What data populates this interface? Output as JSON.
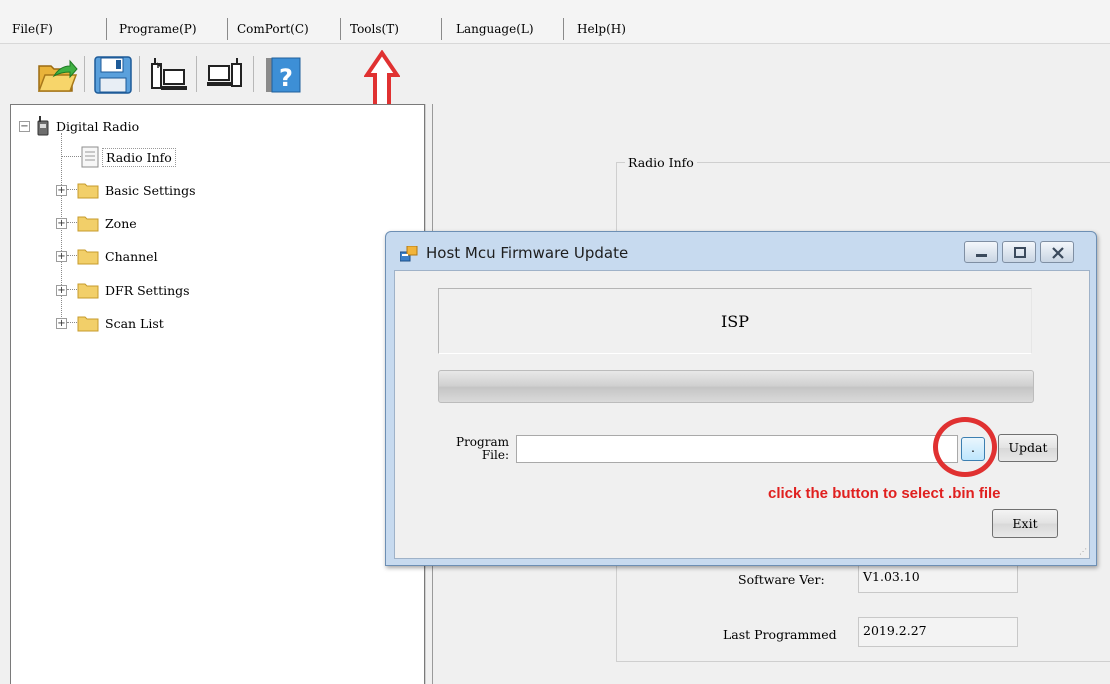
{
  "menu": {
    "items": [
      "File(F)",
      "Programe(P)",
      "ComPort(C)",
      "Tools(T)",
      "Language(L)",
      "Help(H)"
    ]
  },
  "toolbar": {
    "buttons": [
      "open-folder-icon",
      "save-disk-icon",
      "read-from-radio-icon",
      "write-to-radio-icon",
      "help-icon"
    ]
  },
  "tree": {
    "root": "Digital Radio",
    "items": [
      "Radio Info",
      "Basic Settings",
      "Zone",
      "Channel",
      "DFR Settings",
      "Scan List"
    ],
    "selected": "Radio Info"
  },
  "radio_info": {
    "group_title": "Radio Info",
    "software_ver_label": "Software Ver:",
    "software_ver_value": "V1.03.10",
    "last_programmed_label": "Last Programmed",
    "last_programmed_value": "2019.2.27"
  },
  "dialog": {
    "title": "Host Mcu Firmware Update",
    "isp_label": "ISP",
    "progress": 0,
    "program_file_label_line1": "Program",
    "program_file_label_line2": "File:",
    "program_file_value": "",
    "browse_label": ".",
    "update_label": "Updat",
    "exit_label": "Exit"
  },
  "annotation": {
    "hint": "click the button to select .bin file",
    "color": "#e0201f"
  }
}
